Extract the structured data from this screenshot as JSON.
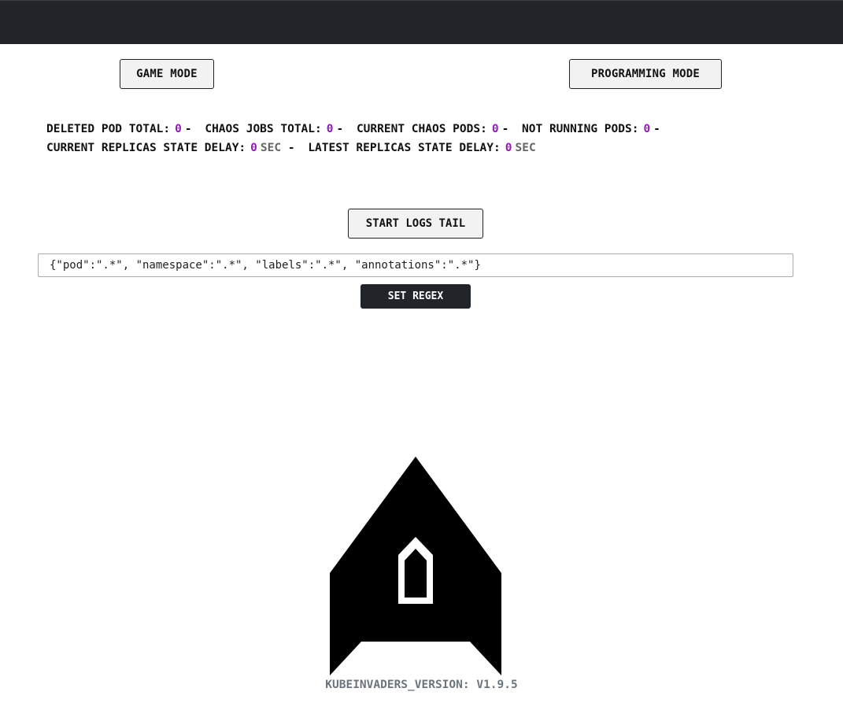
{
  "modes": {
    "game_label": "Game Mode",
    "programming_label": "Programming Mode"
  },
  "stats": {
    "deleted_pod_total": {
      "label": "Deleted Pod Total:",
      "value": "0"
    },
    "chaos_jobs_total": {
      "label": "Chaos Jobs Total:",
      "value": "0"
    },
    "current_chaos_pods": {
      "label": "Current Chaos Pods:",
      "value": "0"
    },
    "not_running_pods": {
      "label": "Not Running Pods:",
      "value": "0"
    },
    "current_replicas_state_delay": {
      "label": "Current Replicas State Delay:",
      "value": "0",
      "unit": "sec"
    },
    "latest_replicas_state_delay": {
      "label": "Latest Replicas State Delay:",
      "value": "0",
      "unit": "sec"
    },
    "separator": "-"
  },
  "logs": {
    "start_label": "Start Logs Tail",
    "regex_value": "{\"pod\":\".*\", \"namespace\":\".*\", \"labels\":\".*\", \"annotations\":\".*\"}",
    "set_regex_label": "Set Regex"
  },
  "footer": {
    "version": "kubeinvaders_version: v1.9.5"
  },
  "icons": {
    "spaceship": "spaceship-icon"
  },
  "colors": {
    "topbar": "#212529",
    "accent_value": "#8e1cb0",
    "muted": "#6c757d"
  }
}
